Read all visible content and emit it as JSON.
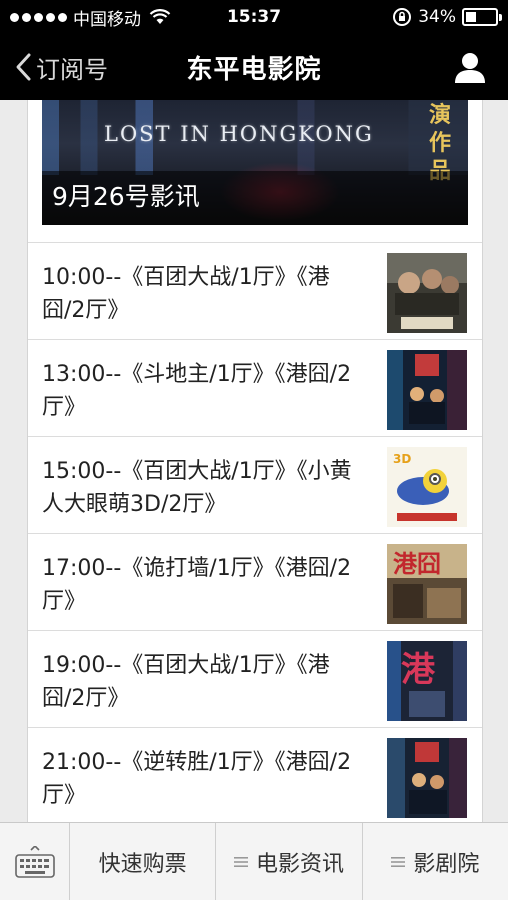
{
  "status_bar": {
    "carrier": "中国移动",
    "time": "15:37",
    "battery": "34%",
    "battery_level": 0.34
  },
  "nav": {
    "back_label": "订阅号",
    "title": "东平电影院"
  },
  "banner": {
    "poster_title": "LOST IN HONGKONG",
    "poster_side_text": "演作品",
    "caption": "9月26号影讯"
  },
  "schedule": [
    {
      "text": "10:00--《百团大战/1厅》《港囧/2厅》",
      "thumb": "poster-baituan"
    },
    {
      "text": "13:00--《斗地主/1厅》《港囧/2厅》",
      "thumb": "poster-doudizhu"
    },
    {
      "text": "15:00--《百团大战/1厅》《小黄人大眼萌3D/2厅》",
      "thumb": "poster-minions"
    },
    {
      "text": "17:00--《诡打墙/1厅》《港囧/2厅》",
      "thumb": "poster-gangjiong"
    },
    {
      "text": "19:00--《百团大战/1厅》《港囧/2厅》",
      "thumb": "poster-gangjiong-2"
    },
    {
      "text": "21:00--《逆转胜/1厅》《港囧/2厅》",
      "thumb": "poster-nizhuansheng"
    }
  ],
  "tab_bar": {
    "tabs": [
      "快速购票",
      "电影资讯",
      "影剧院"
    ]
  },
  "colors": {
    "bar_background": "#000000",
    "page_background": "#ebebeb",
    "tab_background": "#f4f4f4"
  }
}
